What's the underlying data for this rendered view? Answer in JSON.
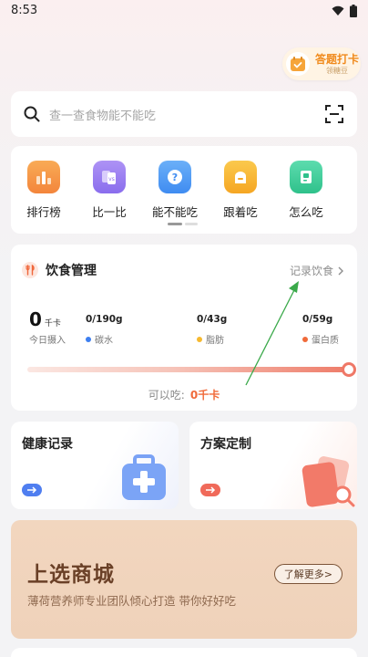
{
  "status_bar": {
    "time": "8:53"
  },
  "checkin": {
    "title": "答题打卡",
    "subtitle": "领糖豆"
  },
  "search": {
    "placeholder": "查一查食物能不能吃"
  },
  "quick_menu": {
    "items": [
      {
        "label": "排行榜",
        "icon": "ranking-icon",
        "color": "#f5923f"
      },
      {
        "label": "比一比",
        "icon": "compare-icon",
        "color": "#9a7ef0"
      },
      {
        "label": "能不能吃",
        "icon": "question-icon",
        "color": "#4f9cf5"
      },
      {
        "label": "跟着吃",
        "icon": "bread-icon",
        "color": "#f7b731"
      },
      {
        "label": "怎么吃",
        "icon": "recipe-icon",
        "color": "#3fcf9a"
      }
    ]
  },
  "diet": {
    "title": "饮食管理",
    "record_link": "记录饮食",
    "kcal_value": "0",
    "kcal_unit": "千卡",
    "kcal_label": "今日摄入",
    "macros": [
      {
        "value": "0/190g",
        "label": "碳水",
        "color": "#3d7ff0"
      },
      {
        "value": "0/43g",
        "label": "脂肪",
        "color": "#f6b92f"
      },
      {
        "value": "0/59g",
        "label": "蛋白质",
        "color": "#f06a3a"
      }
    ],
    "can_eat_label": "可以吃:",
    "can_eat_value": "0千卡"
  },
  "features": {
    "health_record": {
      "title": "健康记录"
    },
    "plan": {
      "title": "方案定制"
    }
  },
  "mall": {
    "title": "上选商城",
    "subtitle": "薄荷营养师专业团队倾心打造 带你好好吃",
    "button": "了解更多>"
  },
  "colors": {
    "accent": "#f06a3a",
    "arrow_blue": "#4f7ef0",
    "arrow_red": "#f06a5a"
  }
}
